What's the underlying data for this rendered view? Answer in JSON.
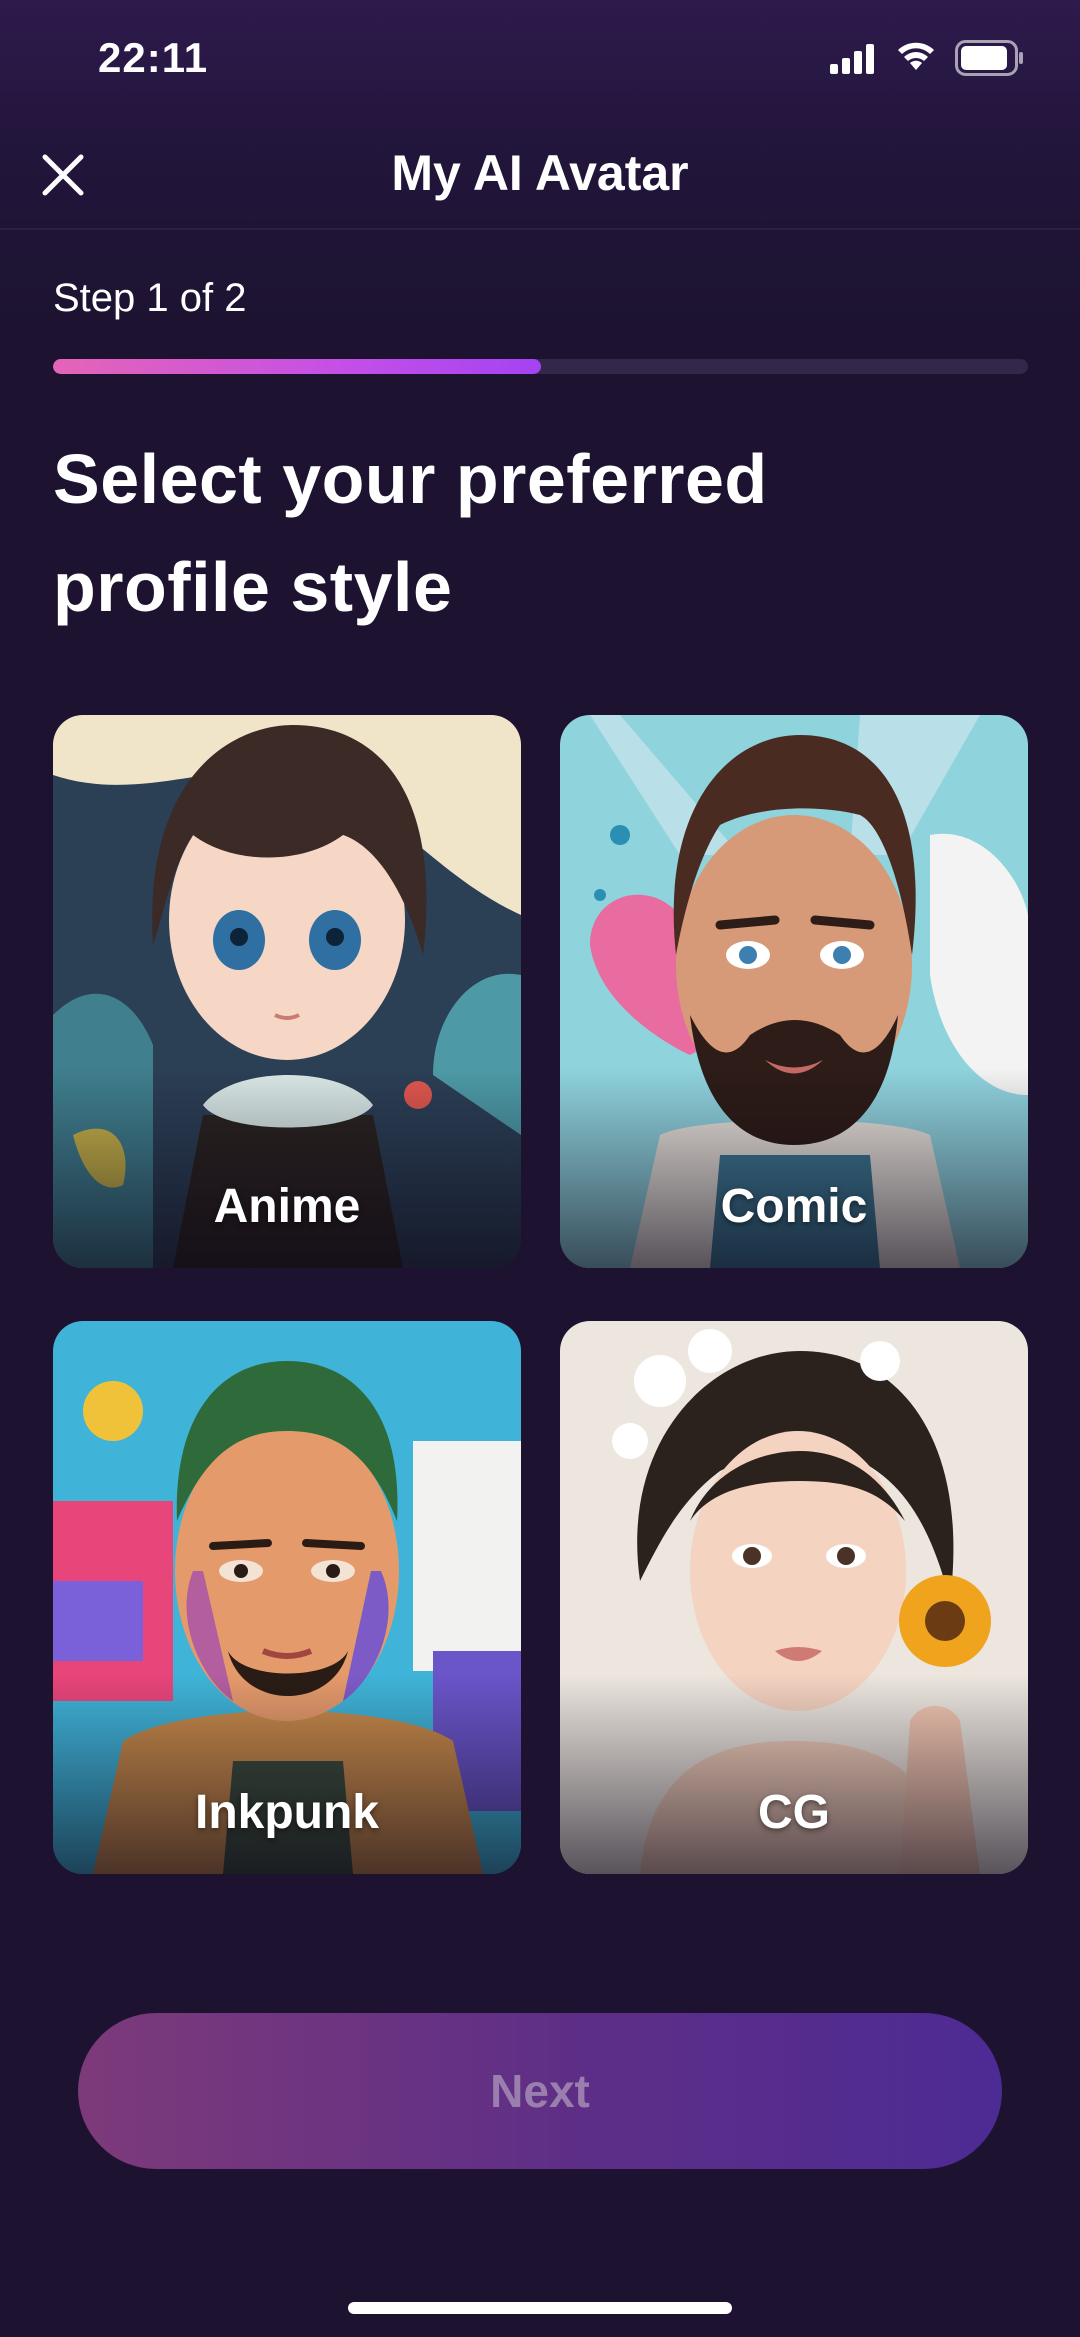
{
  "status_bar": {
    "time": "22:11"
  },
  "header": {
    "title": "My AI Avatar"
  },
  "step": {
    "label": "Step 1 of 2",
    "progress": 0.5
  },
  "headline": {
    "line1": "Select your preferred",
    "line2": "profile style"
  },
  "styles": [
    {
      "label": "Anime"
    },
    {
      "label": "Comic"
    },
    {
      "label": "Inkpunk"
    },
    {
      "label": "CG"
    }
  ],
  "next_button": {
    "label": "Next"
  },
  "colors": {
    "background": "#1d1331",
    "progress_start": "#e465b6",
    "progress_end": "#a443f2",
    "button_start": "#7d3a7a",
    "button_end": "#4d2b94"
  }
}
